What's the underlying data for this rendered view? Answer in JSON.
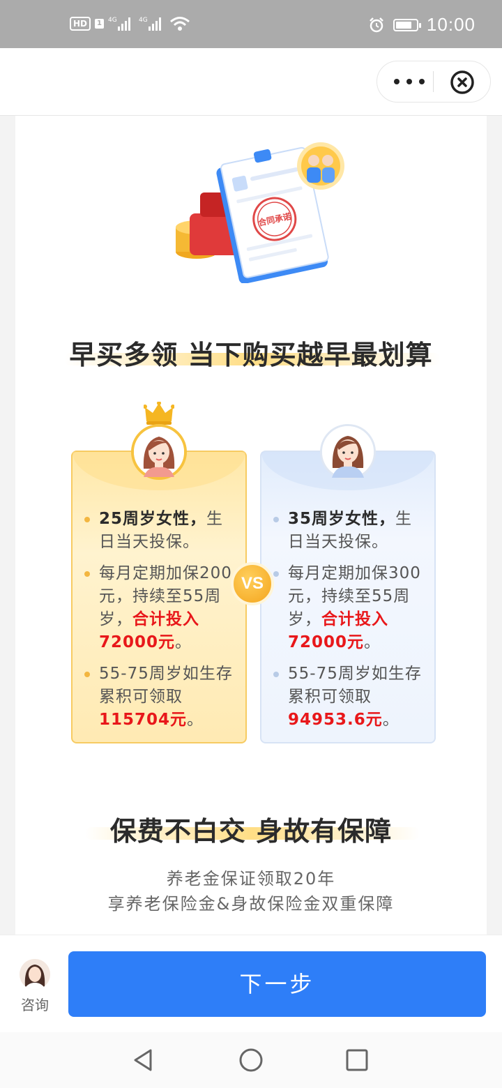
{
  "status_bar": {
    "hd_label": "HD",
    "sim_label": "1",
    "network_1": "4G",
    "network_2": "4G",
    "battery_level": 0.7,
    "time": "10:00"
  },
  "top_bar": {
    "more_icon": "more-dots-icon",
    "close_icon": "close-circle-icon"
  },
  "hero": {
    "stamp_text": "合同承诺"
  },
  "section1": {
    "title": "早买多领 当下购买越早最划算"
  },
  "compare": {
    "vs_label": "VS",
    "left": {
      "b1_bold": "25周岁女性，",
      "b1_rest": "生日当天投保。",
      "b2_pre": "每月定期加保200元，持续至55周岁，",
      "b2_red": "合计投入72000元",
      "b2_post": "。",
      "b3_pre": "55-75周岁如生存累积可领取",
      "b3_red": "115704元",
      "b3_post": "。"
    },
    "right": {
      "b1_bold": "35周岁女性，",
      "b1_rest": "生日当天投保。",
      "b2_pre": "每月定期加保300元，持续至55周岁，",
      "b2_red": "合计投入72000元",
      "b2_post": "。",
      "b3_pre": "55-75周岁如生存累积可领取",
      "b3_red": "94953.6元",
      "b3_post": "。"
    }
  },
  "section2": {
    "title": "保费不白交 身故有保障",
    "line1": "养老金保证领取20年",
    "line2": "享养老保险金&身故保险金双重保障"
  },
  "bottom": {
    "consult_label": "咨询",
    "next_label": "下一步"
  },
  "colors": {
    "primary": "#2e7ef8",
    "highlight_red": "#e8171a",
    "gold": "#f7cb62"
  }
}
